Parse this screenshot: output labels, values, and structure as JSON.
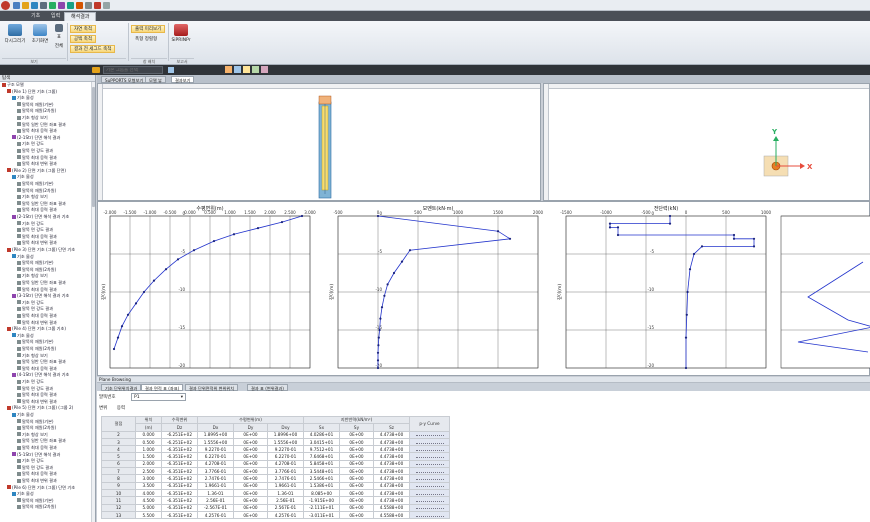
{
  "ribbon": {
    "tabs": [
      "기초",
      "입력",
      "해석결과"
    ],
    "active_tab": 2,
    "buttons": {
      "redraw": "다시그리기",
      "reset": "초기화면",
      "table": "표",
      "fit": "전체",
      "s1": "자연 축척",
      "s2": "공백 축척",
      "s3": "결과 전 세그드 축척",
      "s4": "출력 미리보기",
      "s5": "폭형 정렬형",
      "s6": "SiPRINPr"
    },
    "groups": [
      "보기",
      "",
      "창 배치",
      "보고서"
    ]
  },
  "toolbar": {
    "search_placeholder": "기본 그룹을 선택"
  },
  "left_panel": {
    "title": "탐색",
    "tree": [
      {
        "t": "구조 모델",
        "l": 0,
        "c": "#c0392b"
      },
      {
        "t": "(Pile 1) 단면 기초 (그룹)",
        "l": 1,
        "c": "#c0392b"
      },
      {
        "t": "기초 물성",
        "l": 2,
        "c": "#2e86c1"
      },
      {
        "t": "말뚝의 재원(기본)",
        "l": 3,
        "c": "#7f8c8d"
      },
      {
        "t": "말뚝의 재원(2차원)",
        "l": 3,
        "c": "#7f8c8d"
      },
      {
        "t": "기초 형상 보기",
        "l": 3,
        "c": "#7f8c8d"
      },
      {
        "t": "말뚝 일반 단면 좌표 결과",
        "l": 3,
        "c": "#7f8c8d"
      },
      {
        "t": "말뚝 최대 응력 결과",
        "l": 3,
        "c": "#7f8c8d"
      },
      {
        "t": "(2-1Str) 단면 해석 결과",
        "l": 2,
        "c": "#8e44ad"
      },
      {
        "t": "기초 면 강도",
        "l": 3,
        "c": "#7f8c8d"
      },
      {
        "t": "말뚝 면 강도 결과",
        "l": 3,
        "c": "#7f8c8d"
      },
      {
        "t": "말뚝 최대 응력 결과",
        "l": 3,
        "c": "#7f8c8d"
      },
      {
        "t": "말뚝 최대 변위 결과",
        "l": 3,
        "c": "#7f8c8d"
      },
      {
        "t": "(Pile 2) 단면 기초 (그룹 단면)",
        "l": 1,
        "c": "#c0392b"
      },
      {
        "t": "기초 물성",
        "l": 2,
        "c": "#2e86c1"
      },
      {
        "t": "말뚝의 재원(기본)",
        "l": 3,
        "c": "#7f8c8d"
      },
      {
        "t": "말뚝의 재원(2차원)",
        "l": 3,
        "c": "#7f8c8d"
      },
      {
        "t": "기초 형상 보기",
        "l": 3,
        "c": "#7f8c8d"
      },
      {
        "t": "말뚝 일반 단면 좌표 결과",
        "l": 3,
        "c": "#7f8c8d"
      },
      {
        "t": "말뚝 최대 응력 결과",
        "l": 3,
        "c": "#7f8c8d"
      },
      {
        "t": "(2-1Str) 단면 해석 결과 기초",
        "l": 2,
        "c": "#8e44ad"
      },
      {
        "t": "기초 면 강도",
        "l": 3,
        "c": "#7f8c8d"
      },
      {
        "t": "말뚝 면 강도 결과",
        "l": 3,
        "c": "#7f8c8d"
      },
      {
        "t": "말뚝 최대 응력 결과",
        "l": 3,
        "c": "#7f8c8d"
      },
      {
        "t": "말뚝 최대 변위 결과",
        "l": 3,
        "c": "#7f8c8d"
      },
      {
        "t": "(Pile 3) 단면 기초 (그룹) 단면 기초",
        "l": 1,
        "c": "#c0392b"
      },
      {
        "t": "기초 물성",
        "l": 2,
        "c": "#2e86c1"
      },
      {
        "t": "말뚝의 재원(기본)",
        "l": 3,
        "c": "#7f8c8d"
      },
      {
        "t": "말뚝의 재원(2차원)",
        "l": 3,
        "c": "#7f8c8d"
      },
      {
        "t": "기초 형상 보기",
        "l": 3,
        "c": "#7f8c8d"
      },
      {
        "t": "말뚝 일반 단면 좌표 결과",
        "l": 3,
        "c": "#7f8c8d"
      },
      {
        "t": "말뚝 최대 응력 결과",
        "l": 3,
        "c": "#7f8c8d"
      },
      {
        "t": "(3-1Str) 단면 해석 결과 기초",
        "l": 2,
        "c": "#8e44ad"
      },
      {
        "t": "기초 면 강도",
        "l": 3,
        "c": "#7f8c8d"
      },
      {
        "t": "말뚝 면 강도 결과",
        "l": 3,
        "c": "#7f8c8d"
      },
      {
        "t": "말뚝 최대 응력 결과",
        "l": 3,
        "c": "#7f8c8d"
      },
      {
        "t": "말뚝 최대 변위 결과",
        "l": 3,
        "c": "#7f8c8d"
      },
      {
        "t": "(Pile 4) 단면 기초 (그룹 기초)",
        "l": 1,
        "c": "#c0392b"
      },
      {
        "t": "기초 물성",
        "l": 2,
        "c": "#2e86c1"
      },
      {
        "t": "말뚝의 재원(기본)",
        "l": 3,
        "c": "#7f8c8d"
      },
      {
        "t": "말뚝의 재원(2차원)",
        "l": 3,
        "c": "#7f8c8d"
      },
      {
        "t": "기초 형상 보기",
        "l": 3,
        "c": "#7f8c8d"
      },
      {
        "t": "말뚝 일반 단면 좌표 결과",
        "l": 3,
        "c": "#7f8c8d"
      },
      {
        "t": "말뚝 최대 응력 결과",
        "l": 3,
        "c": "#7f8c8d"
      },
      {
        "t": "(4-1Str) 단면 해석 결과 기초",
        "l": 2,
        "c": "#8e44ad"
      },
      {
        "t": "기초 면 강도",
        "l": 3,
        "c": "#7f8c8d"
      },
      {
        "t": "말뚝 면 강도 결과",
        "l": 3,
        "c": "#7f8c8d"
      },
      {
        "t": "말뚝 최대 응력 결과",
        "l": 3,
        "c": "#7f8c8d"
      },
      {
        "t": "말뚝 최대 변위 결과",
        "l": 3,
        "c": "#7f8c8d"
      },
      {
        "t": "(Pile 5) 단면 기초 (그룹) (그룹 2)",
        "l": 1,
        "c": "#c0392b"
      },
      {
        "t": "기초 물성",
        "l": 2,
        "c": "#2e86c1"
      },
      {
        "t": "말뚝의 재원(기본)",
        "l": 3,
        "c": "#7f8c8d"
      },
      {
        "t": "말뚝의 재원(2차원)",
        "l": 3,
        "c": "#7f8c8d"
      },
      {
        "t": "기초 형상 보기",
        "l": 3,
        "c": "#7f8c8d"
      },
      {
        "t": "말뚝 일반 단면 좌표 결과",
        "l": 3,
        "c": "#7f8c8d"
      },
      {
        "t": "말뚝 최대 응력 결과",
        "l": 3,
        "c": "#7f8c8d"
      },
      {
        "t": "(5-1Str) 단면 해석 결과",
        "l": 2,
        "c": "#8e44ad"
      },
      {
        "t": "기초 면 강도",
        "l": 3,
        "c": "#7f8c8d"
      },
      {
        "t": "말뚝 면 강도 결과",
        "l": 3,
        "c": "#7f8c8d"
      },
      {
        "t": "말뚝 최대 응력 결과",
        "l": 3,
        "c": "#7f8c8d"
      },
      {
        "t": "말뚝 최대 변위 결과",
        "l": 3,
        "c": "#7f8c8d"
      },
      {
        "t": "(Pile 6) 단면 기초 (그룹) 단면 기초",
        "l": 1,
        "c": "#c0392b"
      },
      {
        "t": "기초 물성",
        "l": 2,
        "c": "#2e86c1"
      },
      {
        "t": "말뚝의 재원(기본)",
        "l": 3,
        "c": "#7f8c8d"
      },
      {
        "t": "말뚝의 재원(2차원)",
        "l": 3,
        "c": "#7f8c8d"
      }
    ]
  },
  "doc_tabs": [
    "SuPPORTS 모형보기",
    "모델 뷰",
    "결과보기"
  ],
  "doc_active": 2,
  "axis_labels": {
    "x": "X",
    "y": "Y"
  },
  "plots_labels": {
    "p1": "수평변위(m)",
    "p2": "모멘트(kN·m)",
    "p3": "전단력(kN)",
    "ylabel": "깊이(m)"
  },
  "chart_data": [
    {
      "type": "line",
      "title": "수평변위(m)",
      "ylabel": "깊이(m)",
      "xlim": [
        -2000,
        3000
      ],
      "ylim": [
        -20,
        0
      ],
      "xticks": [
        "-2.000",
        "-1.500",
        "-1.000",
        "-0.500",
        "0.000",
        "0.500",
        "1.000",
        "1.500",
        "2.000",
        "2.500",
        "3.000"
      ],
      "yticks": [
        "0",
        "-5",
        "-10",
        "-15",
        "-20"
      ],
      "x": [
        2800,
        2300,
        1700,
        1100,
        600,
        100,
        -300,
        -600,
        -900,
        -1150,
        -1350,
        -1550,
        -1700,
        -1800,
        -1900
      ],
      "y": [
        0,
        -0.8,
        -1.6,
        -2.4,
        -3.3,
        -4.5,
        -5.7,
        -7,
        -8.5,
        -10,
        -11.5,
        -13,
        -14.5,
        -16,
        -17.5
      ]
    },
    {
      "type": "line",
      "title": "모멘트(kN·m)",
      "ylabel": "깊이(m)",
      "xlim": [
        -500,
        2000
      ],
      "ylim": [
        -20,
        0
      ],
      "xticks": [
        "-500",
        "0",
        "500",
        "1000",
        "1500",
        "2000"
      ],
      "yticks": [
        "0",
        "-5",
        "-10",
        "-15",
        "-20"
      ],
      "x": [
        0,
        1500,
        1650,
        400,
        300,
        200,
        120,
        80,
        50,
        30,
        20,
        10,
        5,
        0,
        0,
        0
      ],
      "y": [
        0,
        -2.0,
        -3.0,
        -4.5,
        -6,
        -7.5,
        -9,
        -10.5,
        -12,
        -13.5,
        -15,
        -16,
        -17,
        -18,
        -19,
        -20
      ]
    },
    {
      "type": "line",
      "title": "전단력(kN)",
      "ylabel": "깊이(m)",
      "xlim": [
        -1500,
        1000
      ],
      "ylim": [
        -20,
        0
      ],
      "xticks": [
        "-1500",
        "-1000",
        "-500",
        "0",
        "500",
        "1000"
      ],
      "yticks": [
        "0",
        "-5",
        "-10",
        "-15",
        "-20"
      ],
      "x": [
        -200,
        -200,
        -950,
        -950,
        -850,
        -850,
        600,
        600,
        850,
        850,
        200,
        100,
        50,
        20,
        10,
        0,
        0
      ],
      "y": [
        0,
        -1.0,
        -1.0,
        -1.5,
        -1.5,
        -2.5,
        -2.5,
        -3.0,
        -3.0,
        -4.0,
        -4.0,
        -5,
        -7,
        -10,
        -13,
        -16,
        -20
      ]
    }
  ],
  "bottom": {
    "title": "Plane Browsing",
    "tabs": [
      "기초 단위위치결과",
      "결과 면적 표 (좌표)",
      "결과 단위면적위 변위위치",
      "결과 표 (변위결과)"
    ],
    "active_tab": 1,
    "selector_label": "말뚝번호",
    "selector_value": "P1",
    "subtabs": [
      "변위",
      "응력"
    ],
    "table": {
      "group_headers": [
        "절점",
        "위치",
        "수직변위",
        "수평변위(m)",
        "지반반력(kN/m²)",
        "p-y Curve"
      ],
      "sub_headers": [
        "",
        "(m)",
        "Dz",
        "Dx",
        "Dy",
        "Dxy",
        "Sx",
        "Sy",
        "Sz",
        ""
      ],
      "rows": [
        [
          "2",
          "0.000",
          "-6.251E+02",
          "1.8995+00",
          "0E+00",
          "1.8996+00",
          "4.0286+01",
          "0E+00",
          "4.4738+00"
        ],
        [
          "3",
          "0.500",
          "-6.251E+02",
          "1.5556+00",
          "0E+00",
          "1.5556+00",
          "3.0415+01",
          "0E+00",
          "4.4738+00"
        ],
        [
          "4",
          "1.000",
          "-6.351E+02",
          "9.2270-01",
          "0E+00",
          "9.2270-01",
          "9.7512+01",
          "0E+00",
          "4.4738+00"
        ],
        [
          "5",
          "1.500",
          "-6.351E+02",
          "6.2270-01",
          "0E+00",
          "6.2270-01",
          "7.6468+01",
          "0E+00",
          "4.4738+00"
        ],
        [
          "6",
          "2.000",
          "-6.351E+02",
          "4.2708-01",
          "0E+00",
          "4.2708-01",
          "5.8458+01",
          "0E+00",
          "4.4738+00"
        ],
        [
          "7",
          "2.500",
          "-6.351E+02",
          "3.7766-01",
          "0E+00",
          "3.7766-01",
          "3.5448+01",
          "0E+00",
          "4.4738+00"
        ],
        [
          "8",
          "3.000",
          "-6.351E+02",
          "2.7476-01",
          "0E+00",
          "2.7476-01",
          "2.5466+01",
          "0E+00",
          "4.4738+00"
        ],
        [
          "9",
          "3.500",
          "-6.351E+02",
          "1.9661-01",
          "0E+00",
          "1.9661-01",
          "1.5386+01",
          "0E+00",
          "4.4738+00"
        ],
        [
          "10",
          "4.000",
          "-6.351E+02",
          "1.36-01",
          "0E+00",
          "1.36-01",
          "8.085+00",
          "0E+00",
          "4.4738+00"
        ],
        [
          "11",
          "4.500",
          "-6.351E+02",
          "2.56E-01",
          "0E+00",
          "2.56E-01",
          "-1.915E+00",
          "0E+00",
          "4.4738+00"
        ],
        [
          "12",
          "5.000",
          "-6.351E+02",
          "-2.567E-01",
          "0E+00",
          "2.567E-01",
          "-2.111E+01",
          "0E+00",
          "4.5588+00"
        ],
        [
          "13",
          "5.500",
          "-6.351E+02",
          "4.2576-01",
          "0E+00",
          "4.2576-01",
          "-3.011E+01",
          "0E+00",
          "4.5588+00"
        ]
      ]
    }
  }
}
